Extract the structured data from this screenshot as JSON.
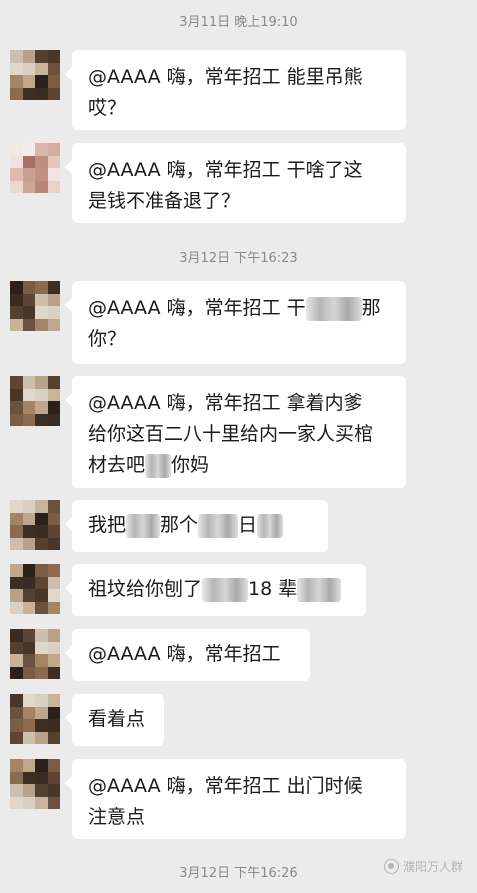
{
  "timestamps": [
    "3月11日 晚上19:10",
    "3月12日 下午16:23",
    "3月12日 下午16:26"
  ],
  "messages": [
    {
      "lines": [
        "@AAAA 嗨，常年招工  能里吊熊",
        "哎？"
      ]
    },
    {
      "lines": [
        "@AAAA 嗨，常年招工  干啥了这",
        "是钱不准备退了？"
      ]
    },
    {
      "line1_pre": "@AAAA 嗨，常年招工  干",
      "line1_post": "那",
      "line2": "你？"
    },
    {
      "line1": "@AAAA 嗨，常年招工  拿着内爹",
      "line2": "给你这百二八十里给内一家人买棺",
      "line3_pre": "材去吧",
      "line3_post": "你妈"
    },
    {
      "pre": "我把",
      "mid": "那个",
      "post": "日"
    },
    {
      "pre": "祖坟给你刨了",
      "mid": "18 辈"
    },
    {
      "text": "@AAAA 嗨，常年招工"
    },
    {
      "text": "看着点"
    },
    {
      "lines": [
        "@AAAA 嗨，常年招工  出门时候",
        "注意点"
      ]
    }
  ],
  "watermark": {
    "text": "濮阳万人群",
    "icon": "wechat-official-account-icon"
  },
  "colors": {
    "background": "#ebebeb",
    "bubble": "#ffffff",
    "timestamp": "#8a8a8a"
  }
}
